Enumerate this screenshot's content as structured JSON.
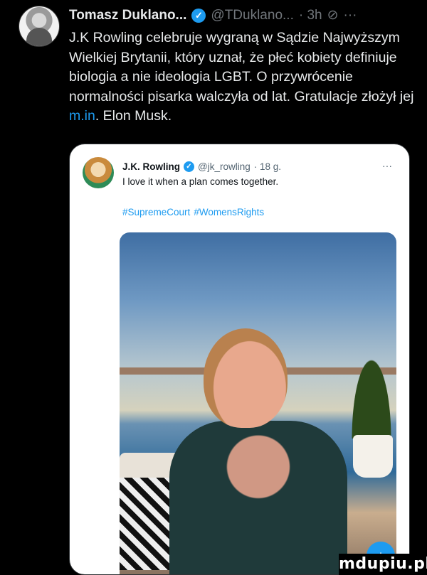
{
  "tweet": {
    "author_name": "Tomasz Duklano...",
    "handle": "@TDuklano...",
    "time": "· 3h",
    "text_parts": {
      "before_link": "J.K Rowling celebruje wygraną w Sądzie Najwyższym Wielkiej Brytanii, który uznał, że płeć kobiety definiuje biologia a nie ideologia LGBT. O przywrócenie normalności pisarka walczyła od lat. Gratulacje złożył jej ",
      "link": "m.in",
      "after_link": ". Elon Musk."
    },
    "icons": {
      "verified": "verified-badge-icon",
      "grok": "grok-icon",
      "more": "more-icon"
    },
    "more_glyph": "···",
    "grok_glyph": "⊘"
  },
  "quoted_tweet": {
    "author_name": "J.K. Rowling",
    "handle": "@jk_rowling",
    "time": "· 18 g.",
    "text": "I love it when a plan comes together.",
    "hashtags": [
      "#SupremeCourt",
      "#WomensRights"
    ],
    "more_glyph": "···",
    "photo_icon": "photo"
  },
  "fab_glyph": "+",
  "watermark": "mdupiu.pl",
  "colors": {
    "accent": "#1d9bf0",
    "background": "#000000",
    "card": "#ffffff"
  }
}
